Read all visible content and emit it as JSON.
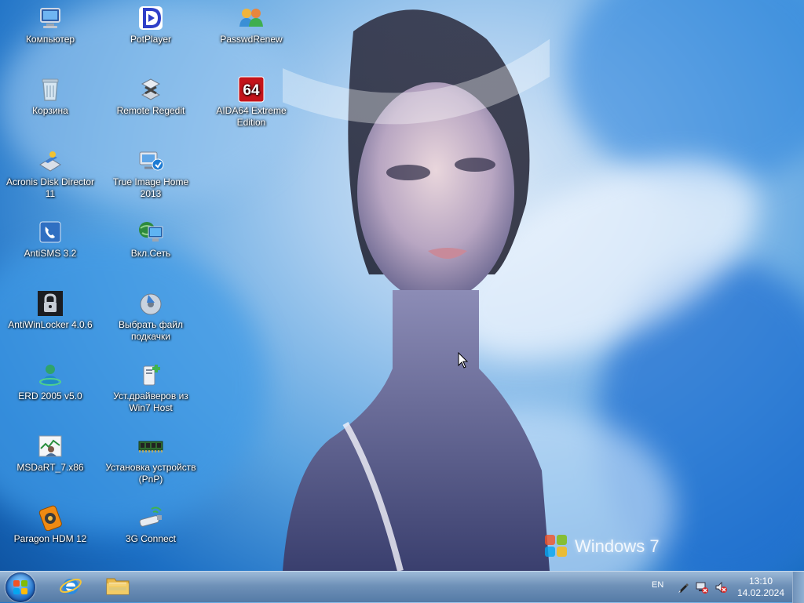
{
  "desktop": {
    "icons": [
      {
        "label": "Компьютер",
        "icon": "computer-icon"
      },
      {
        "label": "PotPlayer",
        "icon": "potplayer-icon"
      },
      {
        "label": "PasswdRenew",
        "icon": "users-icon"
      },
      {
        "label": "Корзина",
        "icon": "recycle-bin-icon"
      },
      {
        "label": "Remote Regedit",
        "icon": "regedit-icon"
      },
      {
        "label": "AIDA64 Extreme Edition",
        "icon": "aida64-icon"
      },
      {
        "label": "Acronis Disk Director 11",
        "icon": "acronis-icon"
      },
      {
        "label": "True Image Home 2013",
        "icon": "true-image-icon"
      },
      {
        "label": "AntiSMS 3.2",
        "icon": "antisms-icon"
      },
      {
        "label": "Вкл.Сеть",
        "icon": "network-icon"
      },
      {
        "label": "AntiWinLocker 4.0.6",
        "icon": "lock-icon"
      },
      {
        "label": "Выбрать файл подкачки",
        "icon": "disk-icon"
      },
      {
        "label": "ERD 2005 v5.0",
        "icon": "erd-icon"
      },
      {
        "label": "Уст.драйверов из Win7 Host",
        "icon": "driver-install-icon"
      },
      {
        "label": "MSDaRT_7.x86",
        "icon": "msdart-icon"
      },
      {
        "label": "Установка устройств (PnP)",
        "icon": "ram-module-icon"
      },
      {
        "label": "Paragon HDM 12",
        "icon": "paragon-icon"
      },
      {
        "label": "3G Connect",
        "icon": "usb-modem-icon"
      }
    ],
    "watermark": "Windows 7"
  },
  "taskbar": {
    "pinned": [
      {
        "name": "internet-explorer",
        "icon": "ie-icon"
      },
      {
        "name": "explorer",
        "icon": "folder-icon"
      }
    ],
    "tray": {
      "language": "EN",
      "icons": [
        "pen-icon",
        "network-disconnected-icon",
        "volume-muted-icon"
      ],
      "time": "13:10",
      "date": "14.02.2024"
    }
  },
  "colors": {
    "taskbar": "#6f91b8",
    "icon_text": "#ffffff",
    "aida_red": "#c4141a",
    "potplayer_blue": "#2f3fc8"
  }
}
